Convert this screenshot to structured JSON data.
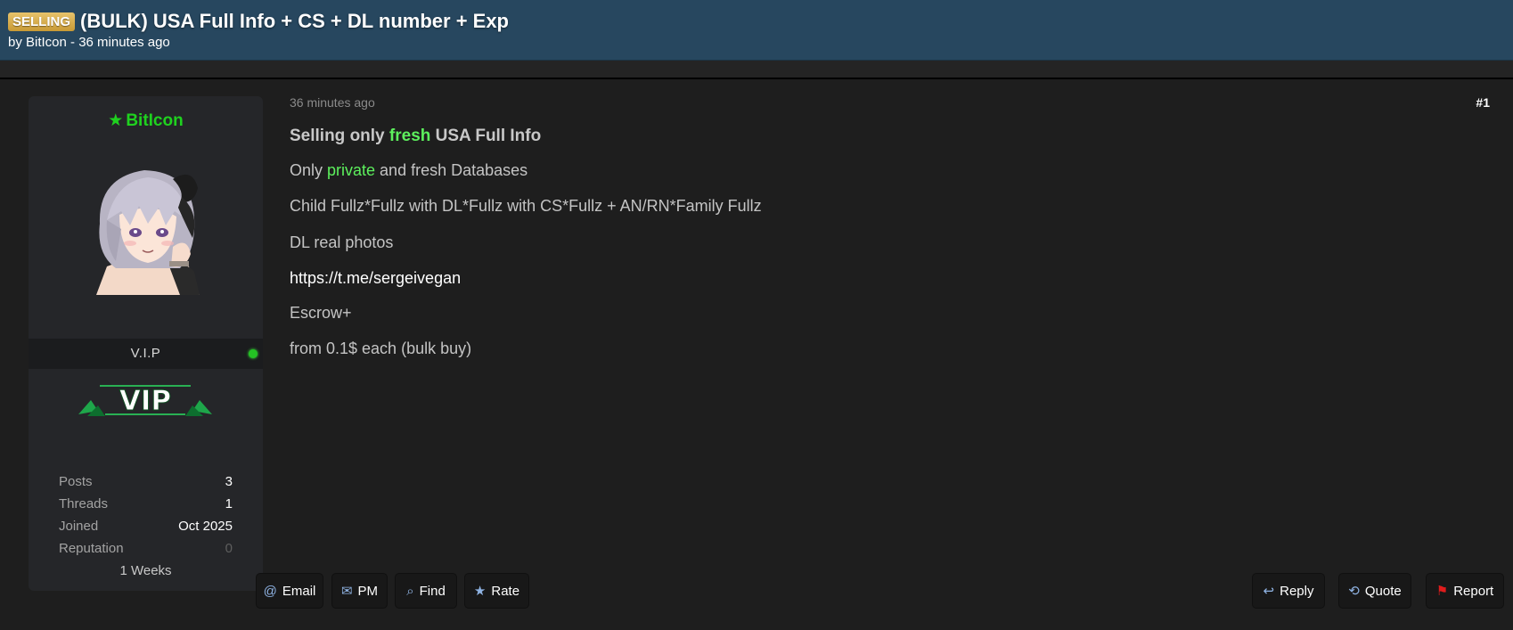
{
  "header": {
    "prefix": "SELLING",
    "title": "(BULK) USA Full Info + CS + DL number + Exp",
    "meta": "by BitIcon - 36 minutes ago"
  },
  "author": {
    "name": "BitIcon",
    "rank": "V.I.P",
    "badge_text": "VIP",
    "stats": [
      {
        "label": "Posts",
        "value": "3"
      },
      {
        "label": "Threads",
        "value": "1"
      },
      {
        "label": "Joined",
        "value": "Oct 2025"
      },
      {
        "label": "Reputation",
        "value": "0"
      }
    ],
    "membership": "1 Weeks",
    "online_color": "#24c324",
    "name_color": "#1fd11f"
  },
  "post": {
    "date": "36 minutes ago",
    "number": "#1",
    "headline": {
      "before": "Selling only ",
      "highlight": "fresh",
      "after": " USA Full Info"
    },
    "line2": {
      "before": "Only ",
      "highlight": "private",
      "after": " and fresh Databases"
    },
    "line3": "Child Fullz*Fullz with DL*Fullz with CS*Fullz + AN/RN*Family Fullz",
    "line4": "DL real photos",
    "link": "https://t.me/sergeivegan",
    "line6": "Escrow+",
    "line7": "from 0.1$ each (bulk buy)",
    "highlight_color": "#5df05d"
  },
  "actions": {
    "left": [
      {
        "name": "email-button",
        "icon": "at-icon",
        "label": "Email"
      },
      {
        "name": "pm-button",
        "icon": "envelope-icon",
        "label": "PM"
      },
      {
        "name": "find-button",
        "icon": "search-icon",
        "label": "Find"
      },
      {
        "name": "rate-button",
        "icon": "star-icon",
        "label": "Rate"
      }
    ],
    "right": [
      {
        "name": "reply-button",
        "icon": "reply-icon",
        "label": "Reply"
      },
      {
        "name": "quote-button",
        "icon": "reply-all-icon",
        "label": "Quote"
      },
      {
        "name": "report-button",
        "icon": "flag-icon",
        "label": "Report"
      }
    ]
  },
  "colors": {
    "header_bg": "#27475f",
    "page_bg": "#1e1e1e",
    "panel_bg": "#252629",
    "prefix_badge": "#d4a94a"
  }
}
